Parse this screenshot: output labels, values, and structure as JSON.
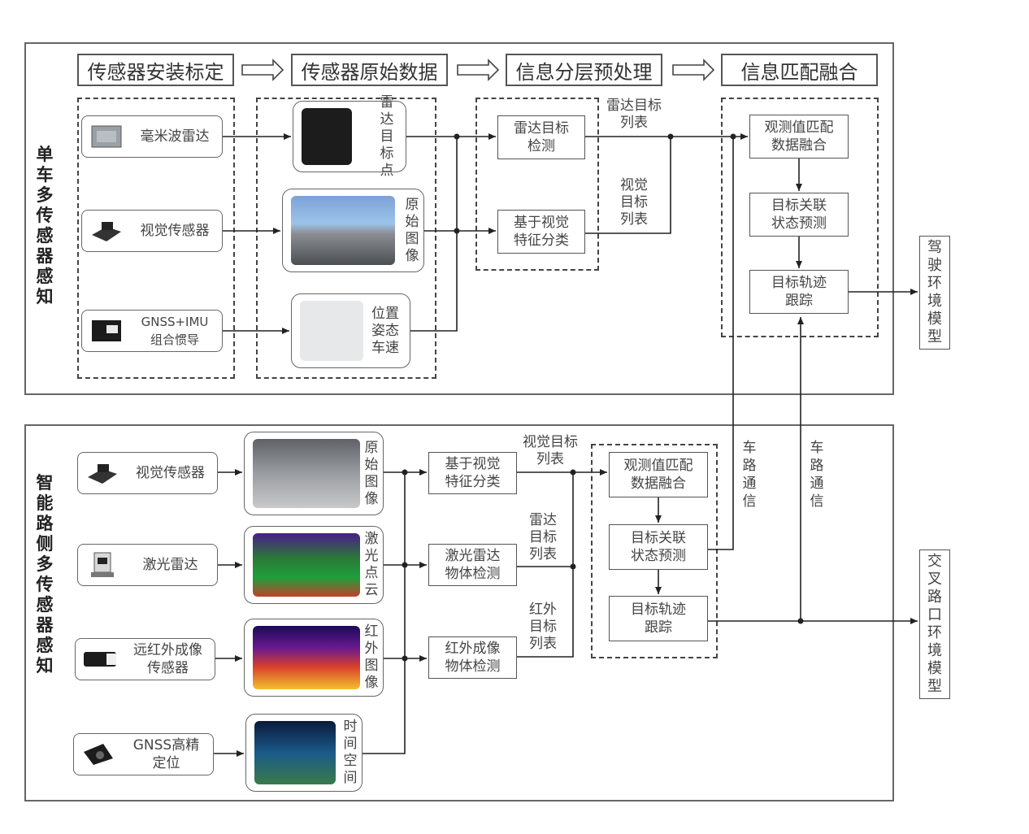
{
  "stages": {
    "s1": "传感器安装标定",
    "s2": "传感器原始数据",
    "s3": "信息分层预处理",
    "s4": "信息匹配融合"
  },
  "vehicle": {
    "title": "单车多传感器感知",
    "sensors": {
      "radar": {
        "label": "毫米波雷达",
        "icon": "radar-sensor-icon"
      },
      "camera": {
        "label": "视觉传感器",
        "icon": "camera-icon"
      },
      "gnss": {
        "label": "GNSS+IMU\n组合惯导",
        "icon": "gnss-imu-icon"
      }
    },
    "data": {
      "radar": "雷达目标点",
      "camera": "原始图像",
      "pose": "位置姿态车速"
    },
    "proc": {
      "radar": "雷达目标\n检测",
      "visual": "基于视觉\n特征分类"
    },
    "notes": {
      "radar_list": "雷达目标\n列表",
      "visual_list": "视觉\n目标\n列表"
    },
    "fusion": {
      "f1": "观测值匹配\n数据融合",
      "f2": "目标关联\n状态预测",
      "f3": "目标轨迹\n跟踪"
    },
    "output": "驾驶环境模型"
  },
  "roadside": {
    "title": "智能路侧多传感器感知",
    "sensors": {
      "camera": {
        "label": "视觉传感器",
        "icon": "camera-icon"
      },
      "lidar": {
        "label": "激光雷达",
        "icon": "lidar-icon"
      },
      "infrared": {
        "label": "远红外成像\n传感器",
        "icon": "infrared-camera-icon"
      },
      "gnss": {
        "label": "GNSS高精\n定位",
        "icon": "gnss-antenna-icon"
      }
    },
    "data": {
      "camera": "原始图像",
      "lidar": "激光点云",
      "infrared": "红外图像",
      "time": "时间空间"
    },
    "proc": {
      "visual": "基于视觉\n特征分类",
      "lidar": "激光雷达\n物体检测",
      "infrared": "红外成像\n物体检测"
    },
    "notes": {
      "visual_list": "视觉目标\n列表",
      "radar_list": "雷达\n目标\n列表",
      "infrared_list": "红外\n目标\n列表"
    },
    "fusion": {
      "f1": "观测值匹配\n数据融合",
      "f2": "目标关联\n状态预测",
      "f3": "目标轨迹\n跟踪"
    },
    "output": "交叉路口环境模型"
  },
  "v2x": {
    "left": "车路通信",
    "right": "车路通信"
  }
}
